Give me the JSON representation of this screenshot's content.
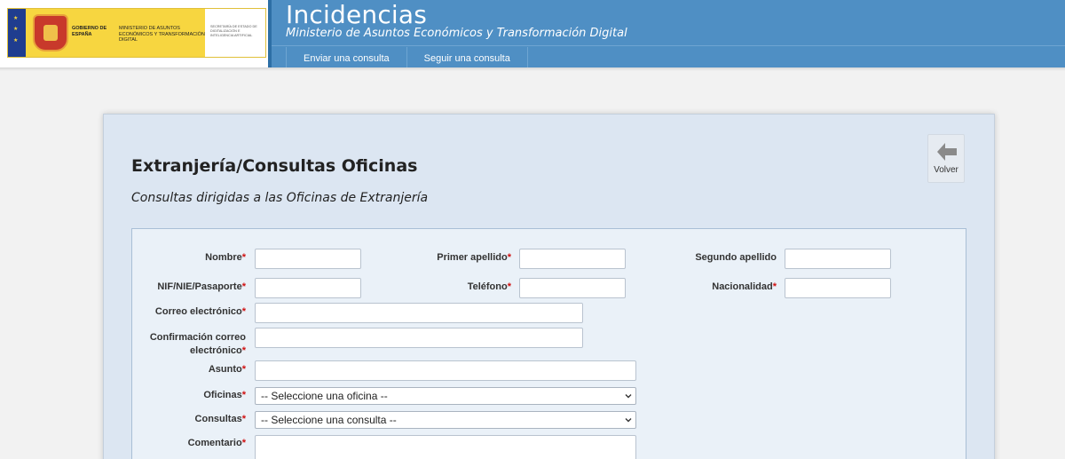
{
  "header": {
    "title": "Incidencias",
    "subtitle": "Ministerio de Asuntos Económicos y Transformación Digital",
    "logo": {
      "gobierno": "GOBIERNO DE ESPAÑA",
      "ministerio": "MINISTERIO DE ASUNTOS ECONÓMICOS Y TRANSFORMACIÓN DIGITAL",
      "secretaria": "SECRETARÍA DE ESTADO DE DIGITALIZACIÓN E INTELIGENCIA ARTIFICIAL"
    },
    "nav": [
      {
        "label": "Enviar una consulta"
      },
      {
        "label": "Seguir una consulta"
      }
    ]
  },
  "panel": {
    "title": "Extranjería/Consultas Oficinas",
    "description": "Consultas dirigidas a las Oficinas de Extranjería",
    "back_label": "Volver"
  },
  "form": {
    "required_mark": "*",
    "nombre": {
      "label": "Nombre",
      "value": ""
    },
    "primer_apellido": {
      "label": "Primer apellido",
      "value": ""
    },
    "segundo_apellido": {
      "label": "Segundo apellido",
      "value": ""
    },
    "nif": {
      "label": "NIF/NIE/Pasaporte",
      "value": ""
    },
    "telefono": {
      "label": "Teléfono",
      "value": ""
    },
    "nacionalidad": {
      "label": "Nacionalidad",
      "value": ""
    },
    "correo": {
      "label": "Correo electrónico",
      "value": ""
    },
    "confirmacion_line1": "Confirmación correo",
    "confirmacion_line2": "electrónico",
    "confirmacion_value": "",
    "asunto": {
      "label": "Asunto",
      "value": ""
    },
    "oficinas": {
      "label": "Oficinas",
      "selected": "-- Seleccione una oficina --"
    },
    "consultas": {
      "label": "Consultas",
      "selected": "-- Seleccione una consulta --"
    },
    "comentario": {
      "label": "Comentario"
    }
  },
  "colors": {
    "header_bg": "#4f8fc4",
    "panel_bg": "#dce6f2",
    "form_bg": "#eaf1f8",
    "required": "#d01010"
  }
}
